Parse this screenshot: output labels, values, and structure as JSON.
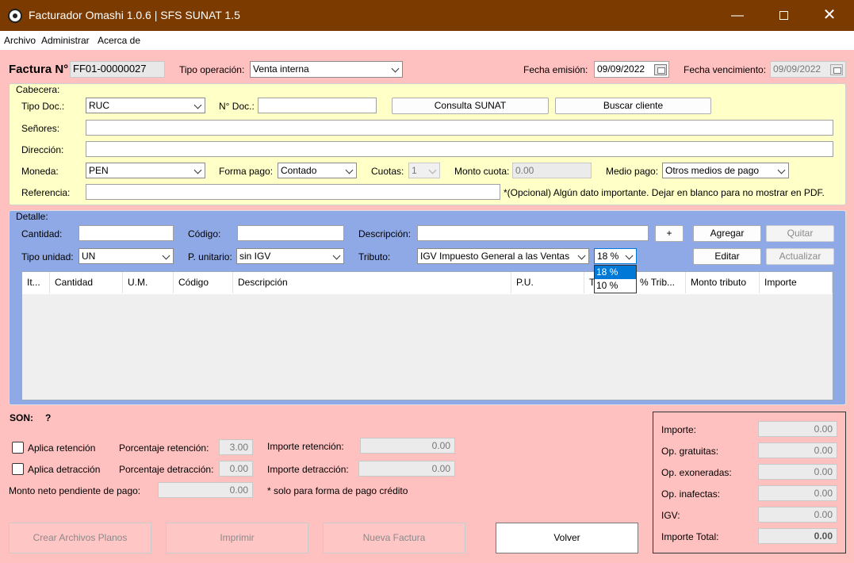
{
  "window": {
    "title": "Facturador Omashi 1.0.6 | SFS SUNAT 1.5"
  },
  "menu": [
    "Archivo",
    "Administrar",
    "Acerca de"
  ],
  "header": {
    "factura_label": "Factura N°",
    "factura_number": "FF01-00000027",
    "tipo_operacion_label": "Tipo operación:",
    "tipo_operacion_value": "Venta interna",
    "fecha_emision_label": "Fecha emisión:",
    "fecha_emision_value": "09/09/2022",
    "fecha_vencimiento_label": "Fecha vencimiento:",
    "fecha_vencimiento_value": "09/09/2022"
  },
  "cabecera": {
    "title": "Cabecera:",
    "tipo_doc_label": "Tipo Doc.:",
    "tipo_doc_value": "RUC",
    "nro_doc_label": "N° Doc.:",
    "nro_doc_value": "",
    "consulta_sunat": "Consulta SUNAT",
    "buscar_cliente": "Buscar cliente",
    "senores_label": "Señores:",
    "direccion_label": "Dirección:",
    "moneda_label": "Moneda:",
    "moneda_value": "PEN",
    "forma_pago_label": "Forma pago:",
    "forma_pago_value": "Contado",
    "cuotas_label": "Cuotas:",
    "cuotas_value": "1",
    "monto_cuota_label": "Monto cuota:",
    "monto_cuota_value": "0.00",
    "medio_pago_label": "Medio pago:",
    "medio_pago_value": "Otros medios de pago",
    "referencia_label": "Referencia:",
    "referencia_note": "*(Opcional) Algún dato importante. Dejar en blanco para no mostrar en PDF."
  },
  "detalle": {
    "title": "Detalle:",
    "cantidad_label": "Cantidad:",
    "codigo_label": "Código:",
    "descripcion_label": "Descripción:",
    "plus_button": "+",
    "agregar": "Agregar",
    "quitar": "Quitar",
    "tipo_unidad_label": "Tipo unidad:",
    "tipo_unidad_value": "UN",
    "p_unitario_label": "P. unitario:",
    "p_unitario_value": "sin IGV",
    "tributo_label": "Tributo:",
    "tributo_value": "IGV Impuesto General a las Ventas",
    "porcentaje_value": "18 %",
    "porcentaje_options": [
      "18 %",
      "10 %"
    ],
    "editar": "Editar",
    "actualizar": "Actualizar",
    "table_headers": [
      "It...",
      "Cantidad",
      "U.M.",
      "Código",
      "Descripción",
      "P.U.",
      "T",
      "% Trib...",
      "Monto tributo",
      "Importe"
    ]
  },
  "footer": {
    "son_label": "SON:",
    "son_value": "?",
    "aplica_retencion": "Aplica retención",
    "porcentaje_retencion_label": "Porcentaje retención:",
    "porcentaje_retencion_value": "3.00",
    "importe_retencion_label": "Importe retención:",
    "importe_retencion_value": "0.00",
    "aplica_detraccion": "Aplica detracción",
    "porcentaje_detraccion_label": "Porcentaje detracción:",
    "porcentaje_detraccion_value": "0.00",
    "importe_detraccion_label": "Importe detracción:",
    "importe_detraccion_value": "0.00",
    "monto_neto_label": "Monto neto pendiente de pago:",
    "monto_neto_value": "0.00",
    "credito_note": "* solo para forma de pago crédito",
    "crear_archivos": "Crear Archivos Planos",
    "imprimir": "Imprimir",
    "nueva_factura": "Nueva Factura",
    "volver": "Volver"
  },
  "totals": {
    "importe_label": "Importe:",
    "importe_value": "0.00",
    "gratuitas_label": "Op. gratuitas:",
    "gratuitas_value": "0.00",
    "exoneradas_label": "Op. exoneradas:",
    "exoneradas_value": "0.00",
    "inafectas_label": "Op. inafectas:",
    "inafectas_value": "0.00",
    "igv_label": "IGV:",
    "igv_value": "0.00",
    "total_label": "Importe Total:",
    "total_value": "0.00"
  },
  "colors": {
    "titlebar": "#7a3a00",
    "background": "#ffc0c0",
    "cabecera_bg": "#ffffc8",
    "detalle_bg": "#8fa8e6"
  }
}
